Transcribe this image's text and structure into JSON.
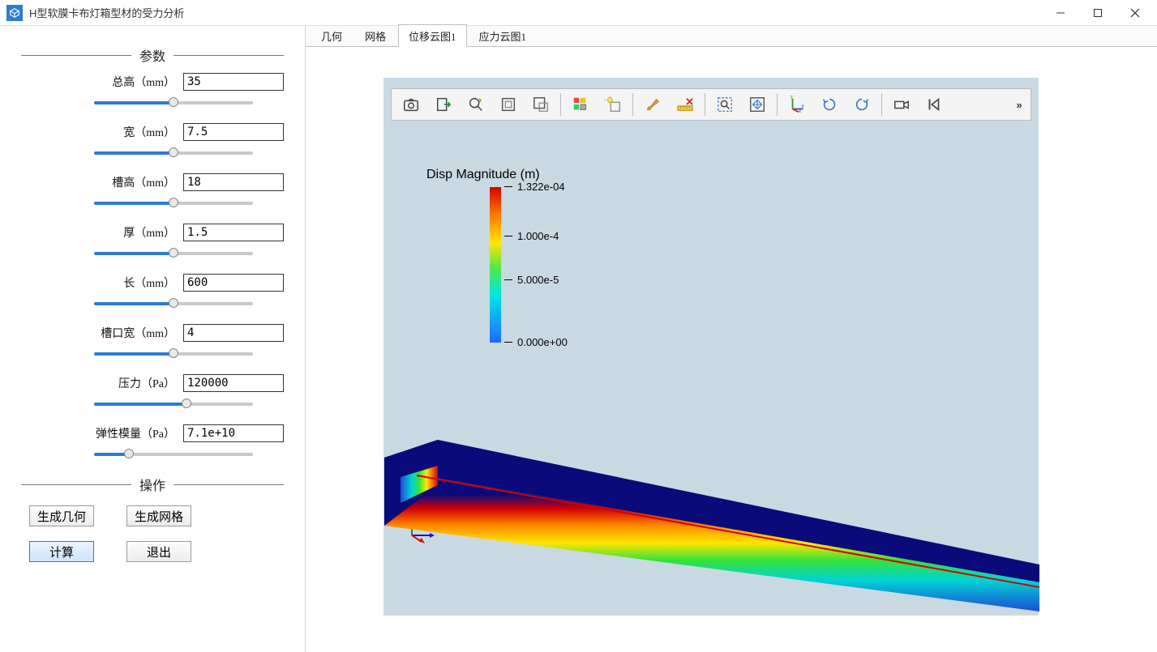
{
  "window": {
    "title": "H型软膜卡布灯箱型材的受力分析"
  },
  "sections": {
    "params_header": "参数",
    "actions_header": "操作"
  },
  "params": {
    "total_height": {
      "label": "总高（mm）",
      "value": "35",
      "slider_pct": 50
    },
    "width": {
      "label": "宽（mm）",
      "value": "7.5",
      "slider_pct": 50
    },
    "slot_height": {
      "label": "槽高（mm）",
      "value": "18",
      "slider_pct": 50
    },
    "thickness": {
      "label": "厚（mm）",
      "value": "1.5",
      "slider_pct": 50
    },
    "length": {
      "label": "长（mm）",
      "value": "600",
      "slider_pct": 50
    },
    "slot_width": {
      "label": "槽口宽（mm）",
      "value": "4",
      "slider_pct": 50
    },
    "pressure": {
      "label": "压力（Pa）",
      "value": "120000",
      "slider_pct": 58
    },
    "elastic_mod": {
      "label": "弹性模量（Pa）",
      "value": "7.1e+10",
      "slider_pct": 22
    }
  },
  "actions": {
    "gen_geom": "生成几何",
    "gen_mesh": "生成网格",
    "compute": "计算",
    "exit": "退出"
  },
  "tabs": {
    "t0": "几何",
    "t1": "网格",
    "t2": "位移云图1",
    "t3": "应力云图1",
    "active": "位移云图1"
  },
  "legend": {
    "title": "Disp Magnitude (m)",
    "ticks": [
      {
        "label": "1.322e-04",
        "pos": 0
      },
      {
        "label": "1.000e-4",
        "pos": 32
      },
      {
        "label": "5.000e-5",
        "pos": 60
      },
      {
        "label": "0.000e+00",
        "pos": 100
      }
    ]
  },
  "toolbar_icons": {
    "screenshot": "screenshot-icon",
    "export": "export-icon",
    "zoom_data": "zoom-data-icon",
    "box1": "bbox-icon",
    "box2": "bbox-select-icon",
    "cubes": "cubes-icon",
    "bulb": "lightbulb-box-icon",
    "brush": "brush-icon",
    "ruler_x": "ruler-clear-icon",
    "zoom_area": "zoom-area-icon",
    "fit": "fit-view-icon",
    "axes": "axes-icon",
    "rotate_cw": "rotate-cw-icon",
    "rotate_ccw": "rotate-ccw-icon",
    "camera": "camera-view-icon",
    "first": "go-first-icon",
    "overflow": "»"
  },
  "colors": {
    "accent": "#2b7cd3",
    "viewport_bg": "#c9d9e2"
  }
}
